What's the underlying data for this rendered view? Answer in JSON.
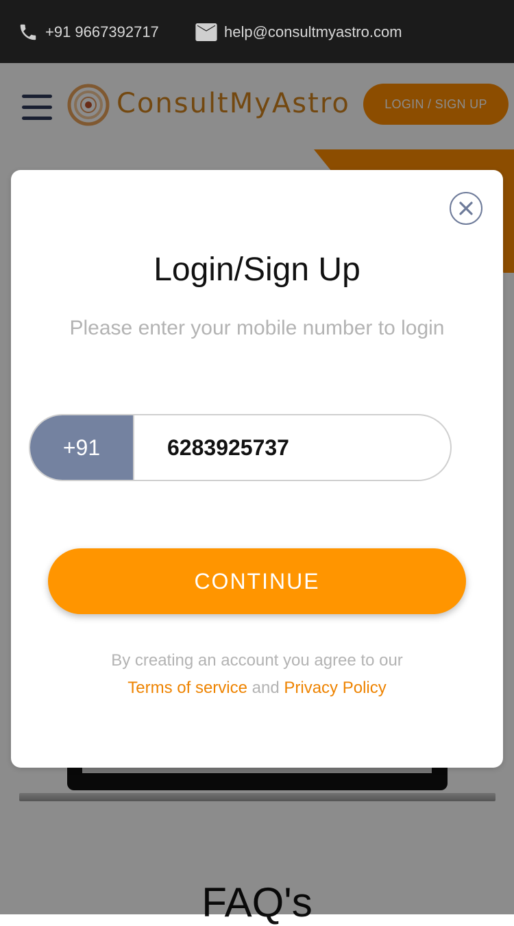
{
  "topbar": {
    "phone": "+91 9667392717",
    "email": "help@consultmyastro.com",
    "phone_icon": "phone-icon",
    "email_icon": "mail-icon"
  },
  "header": {
    "brand": "ConsultMyAstro",
    "login_label": "LOGIN / SIGN UP",
    "menu_icon": "hamburger-menu-icon"
  },
  "background": {
    "faq_title": "FAQ's"
  },
  "modal": {
    "title": "Login/Sign Up",
    "subtitle": "Please enter your mobile number to login",
    "country_code": "+91",
    "phone_value": "6283925737",
    "continue_label": "CONTINUE",
    "terms_intro": "By creating an account you agree to our",
    "terms_link": "Terms of service",
    "terms_and": " and ",
    "privacy_link": "Privacy Policy",
    "close_icon": "close-icon"
  },
  "colors": {
    "accent": "#ff9500",
    "brand_text": "#d2841e",
    "topbar_bg": "#1b1b1b",
    "country_code_bg": "#7482a0",
    "link": "#ee8300"
  }
}
